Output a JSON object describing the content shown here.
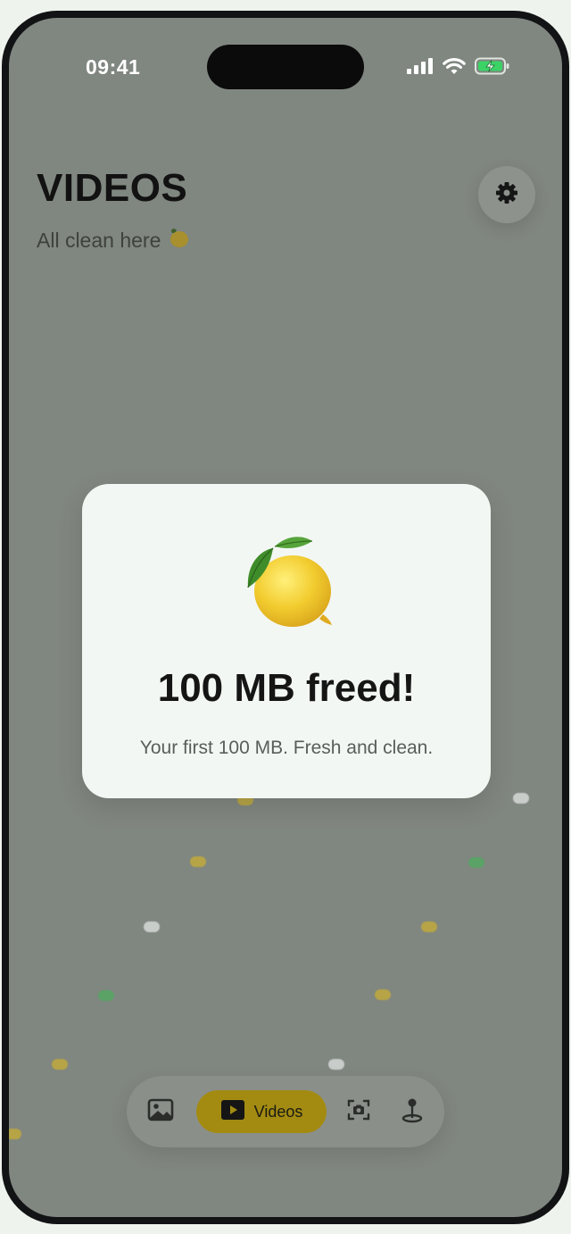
{
  "status_bar": {
    "time": "09:41"
  },
  "header": {
    "title": "VIDEOS",
    "subtitle": "All clean here"
  },
  "modal": {
    "title": "100 MB freed!",
    "message": "Your first 100 MB. Fresh and clean."
  },
  "tab_bar": {
    "tabs": [
      {
        "icon": "photo-icon",
        "label": "",
        "active": false
      },
      {
        "icon": "play-icon",
        "label": "Videos",
        "active": true
      },
      {
        "icon": "screenshot-icon",
        "label": "",
        "active": false
      },
      {
        "icon": "location-pin-icon",
        "label": "",
        "active": false
      }
    ]
  },
  "colors": {
    "background_dim": "#808680",
    "accent": "#a38b12",
    "modal_bg": "#f3f7f3",
    "lemon": "#f3cf3a",
    "leaf": "#3e8a2e"
  }
}
